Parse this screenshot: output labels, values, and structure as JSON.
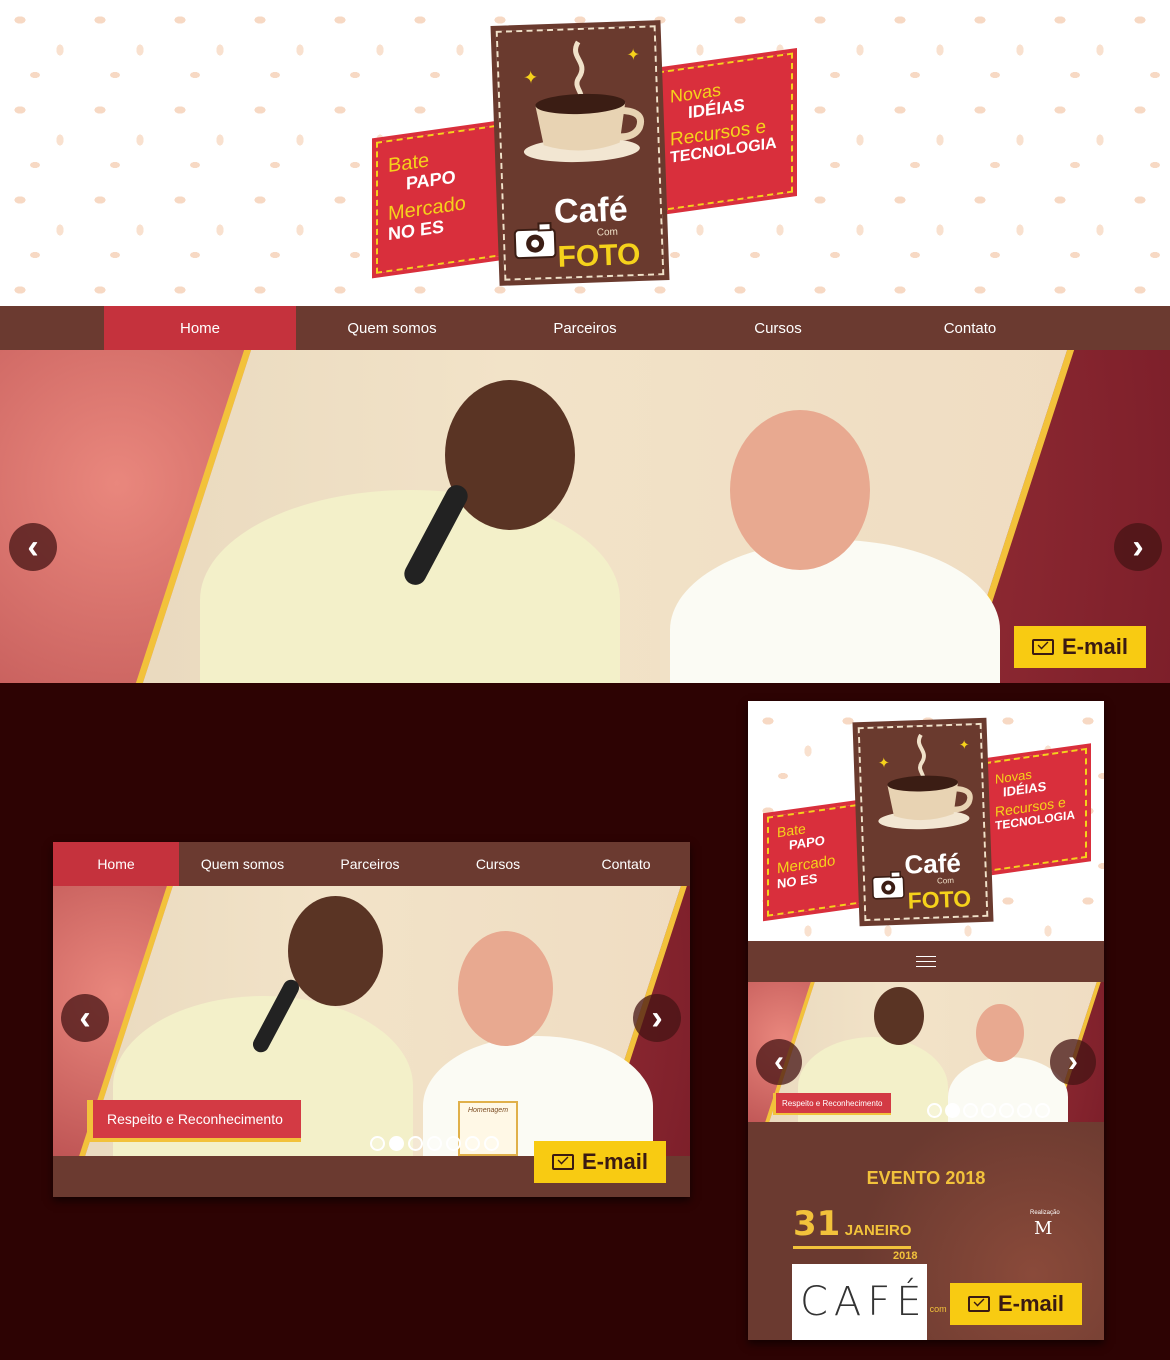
{
  "logo": {
    "left": [
      "Bate",
      "PAPO",
      "Mercado",
      "NO ES"
    ],
    "right": [
      "Novas",
      "IDÉIAS",
      "Recursos e",
      "TECNOLOGIA"
    ],
    "cafe": "Café",
    "com": "Com",
    "foto": "FOTO"
  },
  "nav": {
    "items": [
      {
        "label": "Home"
      },
      {
        "label": "Quem somos"
      },
      {
        "label": "Parceiros"
      },
      {
        "label": "Cursos"
      },
      {
        "label": "Contato"
      }
    ]
  },
  "slider": {
    "prev": "‹",
    "next": "›",
    "caption": "Respeito e Reconhecimento",
    "plaque": "Homenagem",
    "dots": 7
  },
  "email_button": {
    "label": "E-mail"
  },
  "mobile": {
    "menu_icon": "hamburger-icon",
    "event_title": "EVENTO 2018",
    "event_day": "31",
    "event_month": "JANEIRO",
    "event_year": "2018",
    "realizacao": "Realização",
    "realizacao_mark": "M",
    "cafe_text": "CAFÉ",
    "com_text": "com"
  },
  "colors": {
    "brown": "#6b3a30",
    "red": "#c5323d",
    "yellow": "#f8cb12",
    "background": "#2d0303"
  }
}
